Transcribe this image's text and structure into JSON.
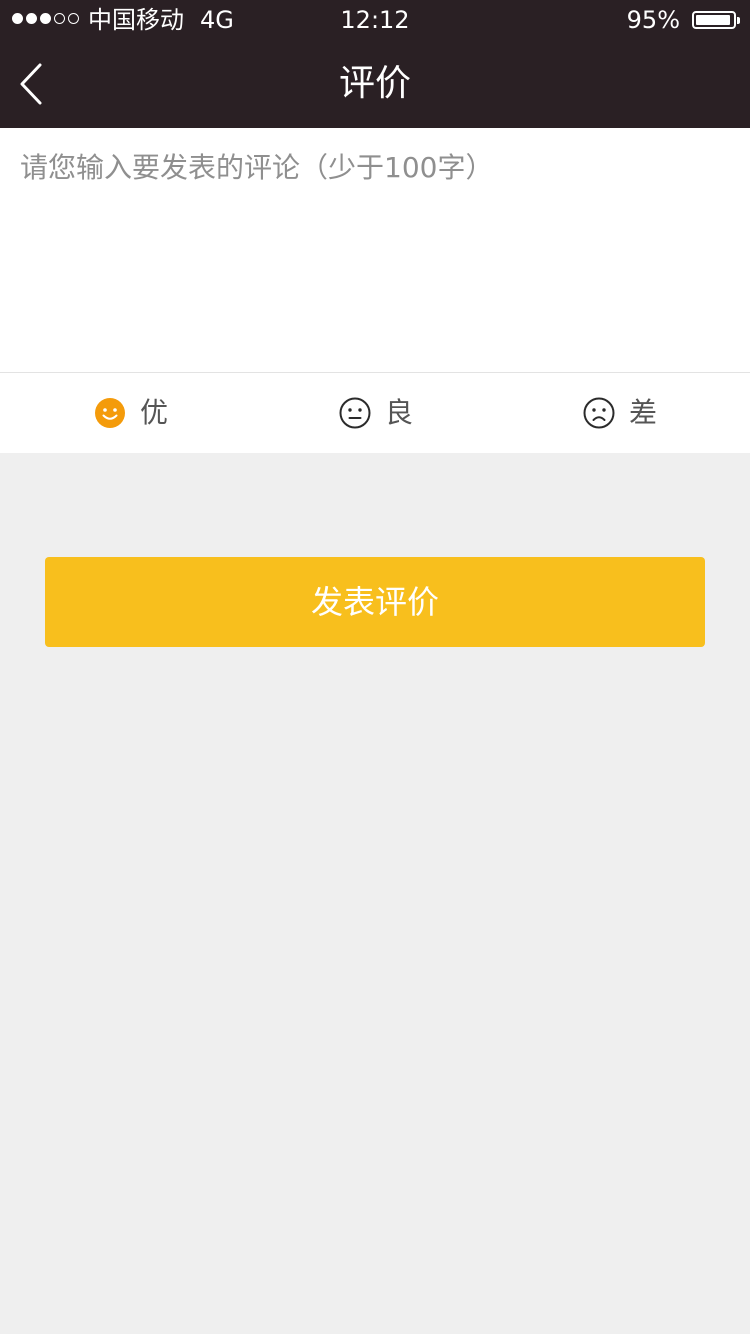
{
  "status_bar": {
    "carrier": "中国移动",
    "network": "4G",
    "time": "12:12",
    "battery_percent": "95%",
    "battery_level": 0.95,
    "signal_bars_filled": 3,
    "signal_bars_total": 5
  },
  "nav": {
    "title": "评价",
    "back_icon": "chevron-left-icon"
  },
  "comment": {
    "value": "",
    "placeholder": "请您输入要发表的评论（少于100字）"
  },
  "rating": {
    "selected": "good",
    "options": [
      {
        "id": "good",
        "label": "优",
        "icon": "smile-icon"
      },
      {
        "id": "mid",
        "label": "良",
        "icon": "neutral-face-icon"
      },
      {
        "id": "bad",
        "label": "差",
        "icon": "frown-icon"
      }
    ]
  },
  "submit": {
    "label": "发表评价"
  },
  "colors": {
    "header_bg": "#2a2024",
    "accent": "#f8bf1d",
    "selected_icon": "#f49b0b",
    "page_bg": "#efefef"
  }
}
